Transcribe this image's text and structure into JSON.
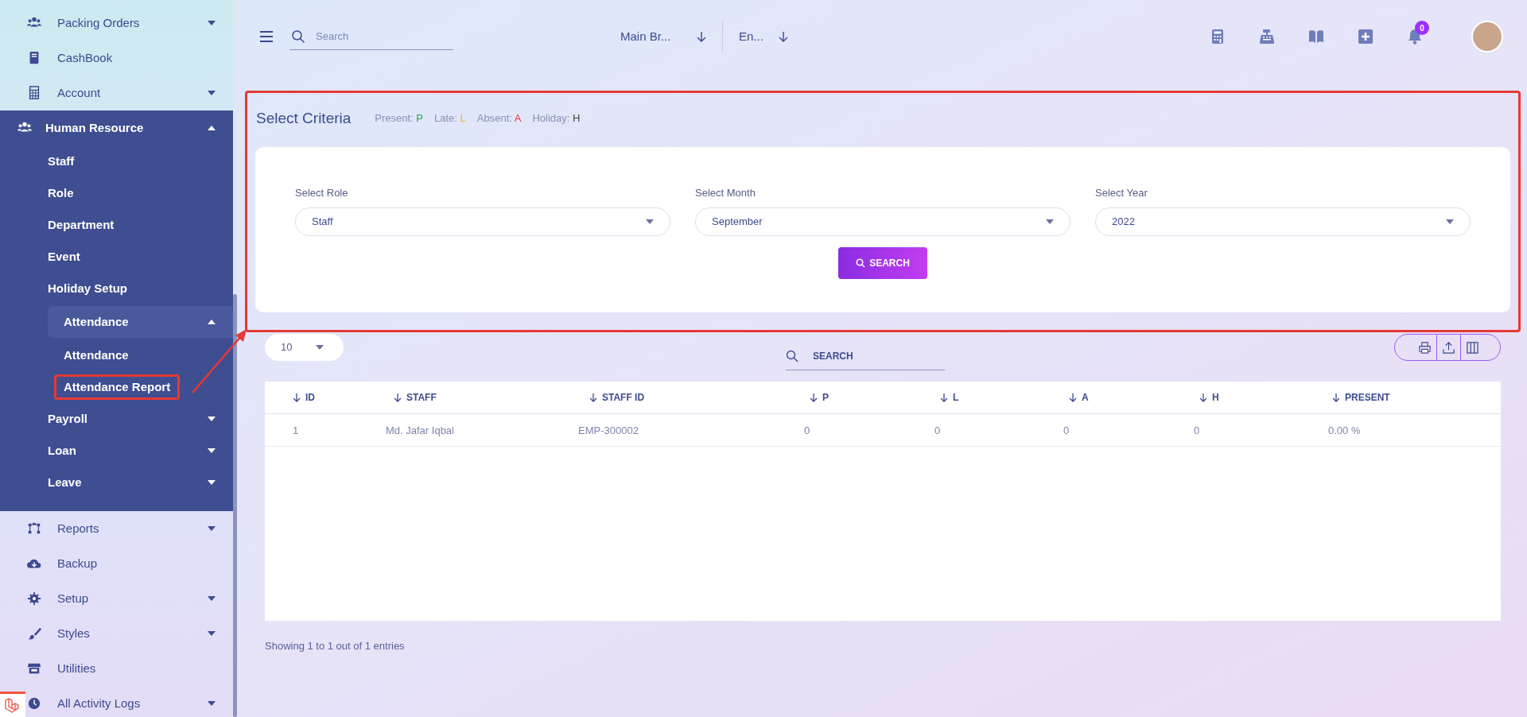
{
  "sidebar": {
    "items": [
      {
        "label": "Packing Orders",
        "expanded": false
      },
      {
        "label": "CashBook"
      },
      {
        "label": "Account",
        "expanded": false
      },
      {
        "label": "Human Resource",
        "expanded": true,
        "children": [
          {
            "label": "Staff"
          },
          {
            "label": "Role"
          },
          {
            "label": "Department"
          },
          {
            "label": "Event"
          },
          {
            "label": "Holiday Setup"
          },
          {
            "label": "Attendance",
            "expanded": true,
            "children": [
              {
                "label": "Attendance",
                "highlighted": false
              },
              {
                "label": "Attendance Report",
                "highlighted": true
              }
            ]
          },
          {
            "label": "Payroll",
            "expanded": false
          },
          {
            "label": "Loan",
            "expanded": false
          },
          {
            "label": "Leave",
            "expanded": false
          }
        ]
      },
      {
        "label": "Reports",
        "expanded": false
      },
      {
        "label": "Backup"
      },
      {
        "label": "Setup",
        "expanded": false
      },
      {
        "label": "Styles",
        "expanded": false
      },
      {
        "label": "Utilities"
      },
      {
        "label": "All Activity Logs",
        "expanded": false
      }
    ]
  },
  "header": {
    "search": {
      "placeholder": "Search"
    },
    "branch": "Main Br...",
    "language": "En...",
    "notification_count": "0"
  },
  "criteria": {
    "title": "Select Criteria",
    "highlighted": true,
    "legend": [
      {
        "label": "Present:",
        "code": "P",
        "color": "#22a845"
      },
      {
        "label": "Late:",
        "code": "L",
        "color": "#f5b800"
      },
      {
        "label": "Absent:",
        "code": "A",
        "color": "#e53945"
      },
      {
        "label": "Holiday:",
        "code": "H",
        "color": "#444444"
      }
    ],
    "fields": [
      {
        "label": "Select Role",
        "value": "Staff"
      },
      {
        "label": "Select Month",
        "value": "September"
      },
      {
        "label": "Select Year",
        "value": "2022"
      }
    ],
    "button": "SEARCH"
  },
  "table_controls": {
    "page_size": "10",
    "search": {
      "placeholder": "SEARCH"
    }
  },
  "table": {
    "columns": [
      "ID",
      "STAFF",
      "STAFF ID",
      "P",
      "L",
      "A",
      "H",
      "PRESENT"
    ],
    "rows": [
      [
        "1",
        "Md. Jafar Iqbal",
        "EMP-300002",
        "0",
        "0",
        "0",
        "0",
        "0.00 %"
      ]
    ]
  },
  "footer": "Showing 1 to 1 out of 1 entries"
}
